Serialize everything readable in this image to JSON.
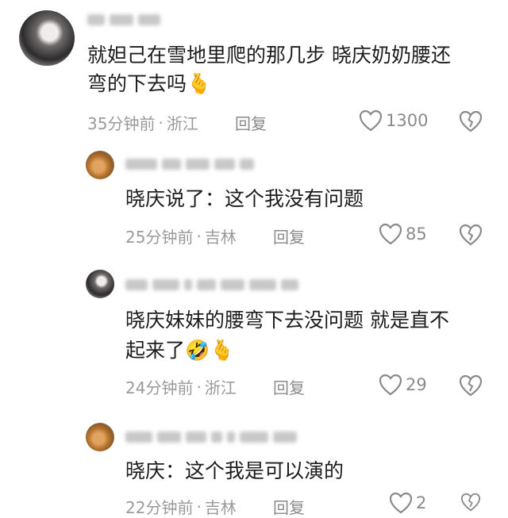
{
  "comments": [
    {
      "text_line1": "就妲己在雪地里爬的那几步 晓庆奶奶腰还",
      "text_line2": "弯的下去吗🫰",
      "time": "35分钟前",
      "location": "浙江",
      "reply_label": "回复",
      "likes": "1300"
    },
    {
      "text_line1": "晓庆说了：这个我没有问题",
      "time": "25分钟前",
      "location": "吉林",
      "reply_label": "回复",
      "likes": "85"
    },
    {
      "text_line1": "晓庆妹妹的腰弯下去没问题 就是直不",
      "text_line2": "起来了🤣🫰",
      "time": "24分钟前",
      "location": "浙江",
      "reply_label": "回复",
      "likes": "29"
    },
    {
      "text_line1": "晓庆：这个我是可以演的",
      "time": "22分钟前",
      "location": "吉林",
      "reply_label": "回复",
      "likes": "2"
    }
  ],
  "separator": "·",
  "icons": {
    "like": "heart-outline-icon",
    "dislike": "broken-heart-icon"
  }
}
